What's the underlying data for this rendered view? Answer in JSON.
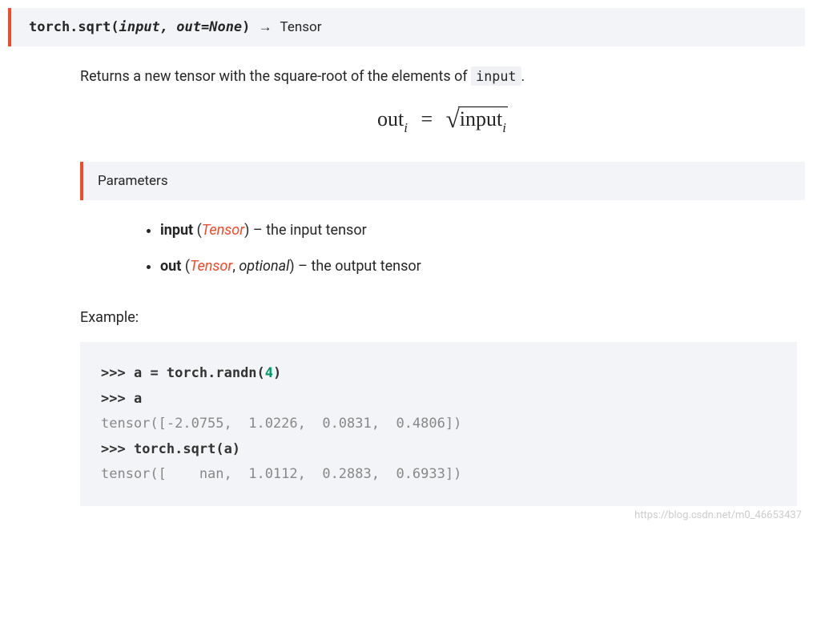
{
  "signature": {
    "fn": "torch.sqrt",
    "open": "(",
    "arg1": "input",
    "sep": ", ",
    "arg2": "out=None",
    "close": ")",
    "arrow": "→",
    "returns": "Tensor"
  },
  "description": {
    "pre": "Returns a new tensor with the square-root of the elements of ",
    "code": "input",
    "post": "."
  },
  "formula": {
    "lhs": "out",
    "lhs_sub": "i",
    "eq": "=",
    "rhs": "input",
    "rhs_sub": "i"
  },
  "parameters": {
    "heading": "Parameters",
    "items": [
      {
        "name": "input",
        "type": "Tensor",
        "optional": false,
        "desc": "the input tensor"
      },
      {
        "name": "out",
        "type": "Tensor",
        "optional": true,
        "optional_label": "optional",
        "desc": "the output tensor"
      }
    ]
  },
  "example": {
    "label": "Example:",
    "lines": [
      {
        "kind": "in",
        "prompt": ">>> ",
        "code_pre": "a ",
        "op": "=",
        "code_mid": " torch",
        "dot": ".",
        "fn": "randn(",
        "num": "4",
        "close": ")"
      },
      {
        "kind": "in",
        "prompt": ">>> ",
        "code_pre": "a"
      },
      {
        "kind": "out",
        "text": "tensor([-2.0755,  1.0226,  0.0831,  0.4806])"
      },
      {
        "kind": "in",
        "prompt": ">>> ",
        "code_pre": "torch",
        "dot": ".",
        "fn": "sqrt(a)"
      },
      {
        "kind": "out",
        "text": "tensor([    nan,  1.0112,  0.2883,  0.6933])"
      }
    ]
  },
  "watermark": "https://blog.csdn.net/m0_46653437"
}
